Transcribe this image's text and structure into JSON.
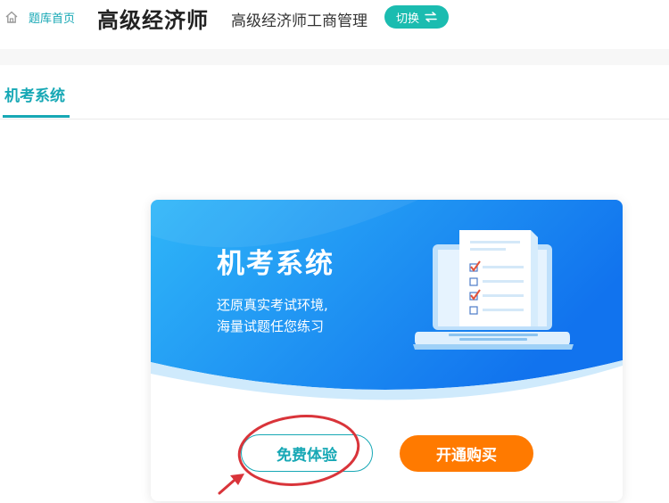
{
  "header": {
    "home_icon": "home-icon",
    "home_label": "题库首页",
    "exam_title": "高级经济师",
    "exam_subject": "高级经济师工商管理",
    "switch_label": "切换",
    "switch_icon": "swap-arrows-icon"
  },
  "tabs": [
    {
      "label": "机考系统",
      "active": true
    }
  ],
  "card": {
    "title": "机考系统",
    "desc_line1": "还原真实考试环境,",
    "desc_line2": "海量试题任您练习",
    "illustration": "laptop-checklist-icon",
    "trial_label": "免费体验",
    "buy_label": "开通购买"
  },
  "colors": {
    "accent": "#17a8b5",
    "switch_bg": "#1bbcb0",
    "banner_start": "#29aef7",
    "banner_end": "#1278f0",
    "buy_bg": "#ff7a00",
    "annotation": "#d9343a"
  }
}
